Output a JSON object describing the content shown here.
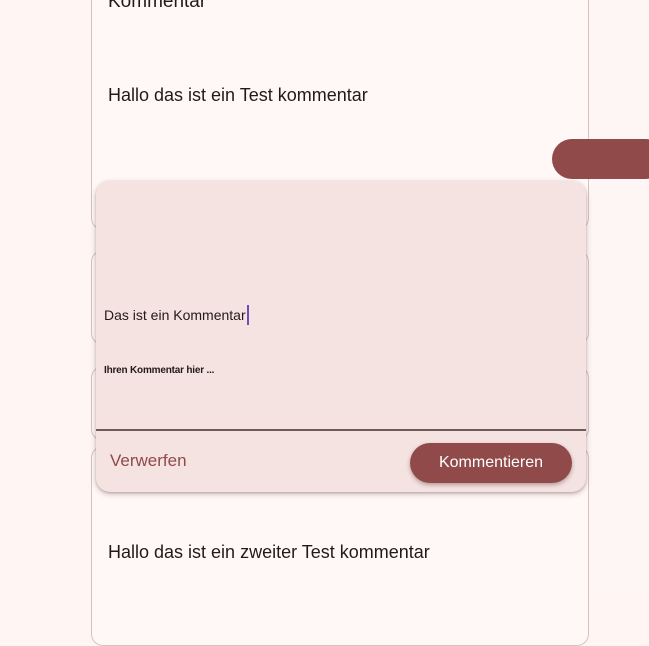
{
  "comments": [
    {
      "title": "Kommentar",
      "text": "Hallo das ist ein Test kommentar"
    },
    {
      "title": "",
      "text": ""
    },
    {
      "title": "",
      "text": ""
    },
    {
      "title": "",
      "text": "Hallo das ist ein zweiter Test kommentar"
    }
  ],
  "dialog": {
    "input_value": "Das ist ein Kommentar",
    "hint": "Ihren Kommentar hier ...",
    "discard_label": "Verwerfen",
    "submit_label": "Kommentieren"
  },
  "colors": {
    "primary": "#904a4a",
    "surface": "#fff8f6",
    "dialog_surface": "#f5e3e1",
    "caret": "#6b4fb8",
    "outline": "#d8c2bf"
  }
}
